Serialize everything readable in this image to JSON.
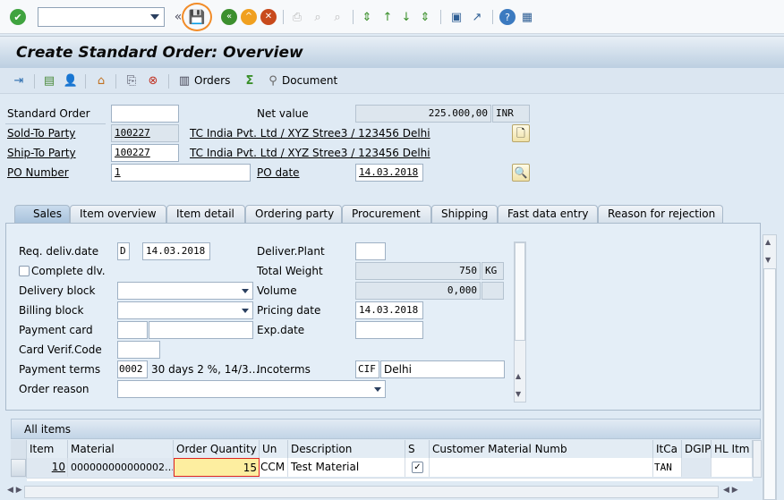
{
  "system_toolbar": {
    "command_field": "",
    "icons": [
      "enter-check-icon",
      "back-icon",
      "save-icon",
      "back-green-icon",
      "exit-icon",
      "cancel-icon",
      "print-icon",
      "find-icon",
      "find-next-icon",
      "first-page-icon",
      "previous-page-icon",
      "next-page-icon",
      "last-page-icon",
      "new-session-icon",
      "shortcut-icon",
      "help-icon",
      "customize-layout-icon"
    ]
  },
  "title": "Create Standard Order: Overview",
  "app_toolbar": {
    "orders_label": "Orders",
    "document_label": "Document"
  },
  "header": {
    "standard_order_label": "Standard Order",
    "standard_order_value": "",
    "net_value_label": "Net value",
    "net_value": "225.000,00",
    "currency": "INR",
    "sold_to_label": "Sold-To Party",
    "sold_to_value": "100227",
    "sold_to_address": "TC India Pvt. Ltd / XYZ Stree3 / 123456 Delhi",
    "ship_to_label": "Ship-To Party",
    "ship_to_value": "100227",
    "ship_to_address": "TC India Pvt. Ltd / XYZ Stree3 / 123456 Delhi",
    "po_number_label": "PO Number",
    "po_number_value": "1",
    "po_date_label": "PO date",
    "po_date_value": "14.03.2018"
  },
  "tabs": [
    "Sales",
    "Item overview",
    "Item detail",
    "Ordering party",
    "Procurement",
    "Shipping",
    "Fast data entry",
    "Reason for rejection"
  ],
  "sales": {
    "req_deliv_label": "Req. deliv.date",
    "req_deliv_type": "D",
    "req_deliv_date": "14.03.2018",
    "deliver_plant_label": "Deliver.Plant",
    "deliver_plant": "",
    "complete_dlv_label": "Complete dlv.",
    "complete_dlv_checked": false,
    "total_weight_label": "Total Weight",
    "total_weight": "750",
    "weight_unit": "KG",
    "delivery_block_label": "Delivery block",
    "delivery_block": "",
    "volume_label": "Volume",
    "volume": "0,000",
    "volume_unit": "",
    "billing_block_label": "Billing block",
    "billing_block": "",
    "pricing_date_label": "Pricing date",
    "pricing_date": "14.03.2018",
    "payment_card_label": "Payment card",
    "payment_card_type": "",
    "payment_card_number": "",
    "exp_date_label": "Exp.date",
    "exp_date": "",
    "card_verif_label": "Card Verif.Code",
    "card_verif": "",
    "payment_terms_label": "Payment terms",
    "payment_terms_code": "0002",
    "payment_terms_text": "30 days 2 %, 14/3…",
    "incoterms_label": "Incoterms",
    "incoterms_code": "CIF",
    "incoterms_place": "Delhi",
    "order_reason_label": "Order reason",
    "order_reason": ""
  },
  "items": {
    "title": "All items",
    "columns": [
      "Item",
      "Material",
      "Order Quantity",
      "Un",
      "Description",
      "S",
      "Customer Material Numb",
      "ItCa",
      "DGIP",
      "HL Itm"
    ],
    "rows": [
      {
        "item": "10",
        "material": "000000000000002…",
        "quantity": "15",
        "unit": "CCM",
        "description": "Test Material",
        "s_checked": true,
        "customer_material": "",
        "itca": "TAN",
        "dgip": "",
        "hl_itm": ""
      }
    ]
  },
  "colors": {
    "highlight": "#f28c28",
    "editing_cell": "#fdeea0"
  }
}
